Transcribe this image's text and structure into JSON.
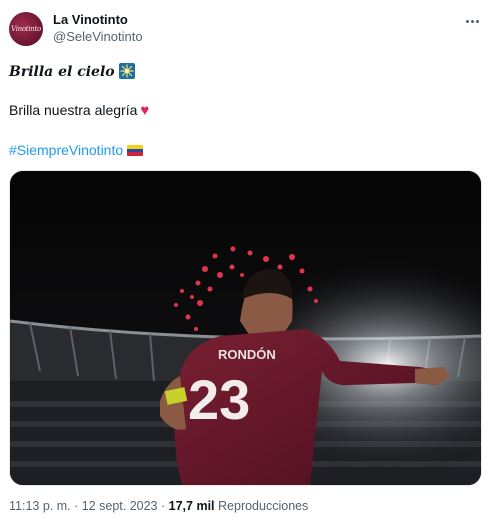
{
  "author": {
    "name": "La Vinotinto",
    "handle": "@SeleVinotinto",
    "avatar_text": "Vinotinto"
  },
  "tweet": {
    "line1": "Brilla el cielo",
    "line1_emoji": "sparkler",
    "line2": "Brilla nuestra alegría",
    "line2_emoji": "red-heart",
    "hashtag": "#SiempreVinotinto",
    "hashtag_emoji": "venezuela-flag"
  },
  "media": {
    "player_name": "RONDÓN",
    "player_number": "23"
  },
  "meta": {
    "time": "11:13 p. m.",
    "separator1": "·",
    "date": "12 sept. 2023",
    "separator2": "·",
    "views_count": "17,7 mil",
    "views_label": "Reproducciones"
  },
  "colors": {
    "text": "#0f1419",
    "secondary": "#536471",
    "link": "#1d9bf0",
    "heart": "#e0245e",
    "jersey": "#6e1a2d"
  }
}
